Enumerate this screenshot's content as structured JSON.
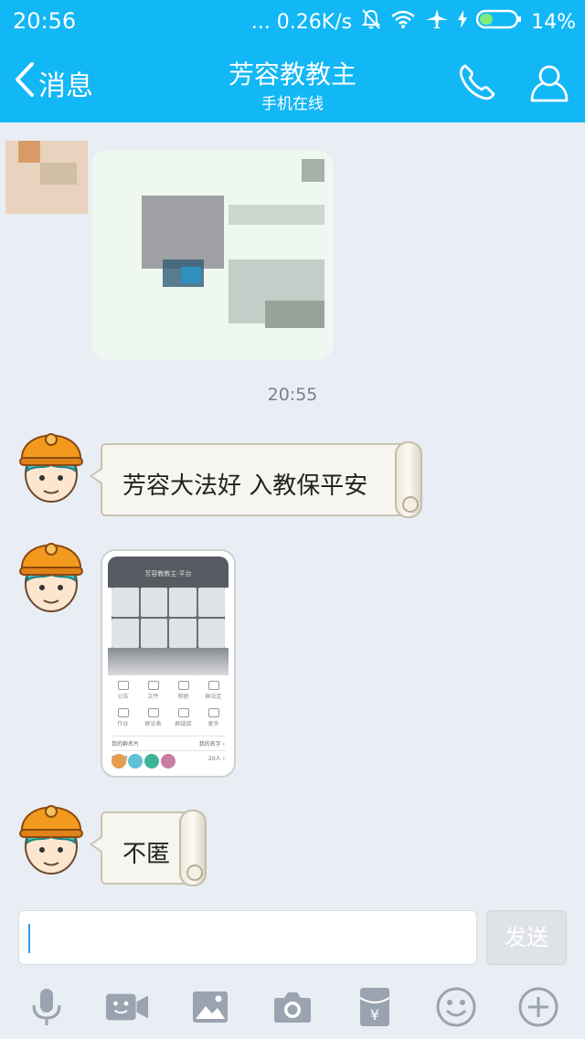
{
  "status_bar": {
    "time": "20:56",
    "network_speed": "... 0.26K/s",
    "battery_percent": "14%",
    "icons": [
      "bell-off-icon",
      "wifi-icon",
      "airplane-icon",
      "charging-icon",
      "battery-icon"
    ]
  },
  "nav": {
    "back_label": "消息",
    "title": "芳容教教主",
    "subtitle": "手机在线",
    "icons": [
      "chevron-left-icon",
      "phone-icon",
      "profile-icon"
    ]
  },
  "chat": {
    "timestamp": "20:55",
    "messages": [
      {
        "type": "text",
        "text": "芳容大法好 入教保平安"
      },
      {
        "type": "image",
        "screenshot": {
          "header": "芳容教教主·平台",
          "menu": [
            "公告",
            "文件",
            "相册",
            "群设定",
            "作业",
            "群论表",
            "群链接",
            "更多"
          ],
          "row1_left": "我的群名片",
          "row1_right": "我的名字 ›",
          "row2_left": "群成员",
          "row2_right": "20人 ›"
        }
      },
      {
        "type": "text",
        "text": "不匿"
      }
    ]
  },
  "composer": {
    "input_value": "",
    "send_label": "发送"
  },
  "toolbar": {
    "items": [
      "microphone-icon",
      "video-icon",
      "image-icon",
      "camera-icon",
      "red-packet-icon",
      "emoji-icon",
      "plus-icon"
    ]
  },
  "colors": {
    "brand_blue": "#12b7f5",
    "chat_background": "#e9edf4",
    "bubble_fill": "#f7f5ef"
  }
}
